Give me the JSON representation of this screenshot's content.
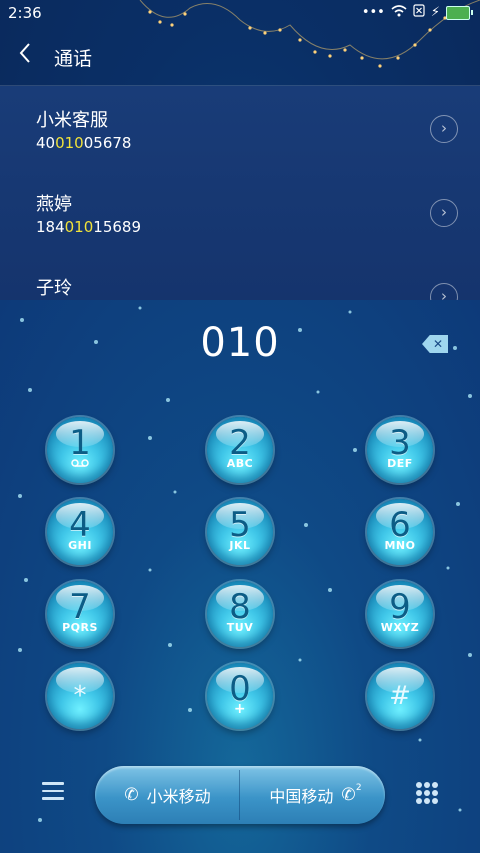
{
  "status_bar": {
    "time": "2:36",
    "icons": [
      "more-icon",
      "wifi-icon",
      "sim-off-icon",
      "charging-icon",
      "battery-icon"
    ]
  },
  "header": {
    "title": "通话"
  },
  "results": [
    {
      "name": "小米客服",
      "number_prefix": "40",
      "number_match": "010",
      "number_suffix": "05678"
    },
    {
      "name": "燕婷",
      "number_prefix": "184",
      "number_match": "010",
      "number_suffix": "15689"
    },
    {
      "name": "子玲",
      "number_prefix": "",
      "number_match": "",
      "number_suffix": ""
    }
  ],
  "dialer": {
    "input": "010",
    "keys": [
      {
        "num": "1",
        "letters": ""
      },
      {
        "num": "2",
        "letters": "ABC"
      },
      {
        "num": "3",
        "letters": "DEF"
      },
      {
        "num": "4",
        "letters": "GHI"
      },
      {
        "num": "5",
        "letters": "JKL"
      },
      {
        "num": "6",
        "letters": "MNO"
      },
      {
        "num": "7",
        "letters": "PQRS"
      },
      {
        "num": "8",
        "letters": "TUV"
      },
      {
        "num": "9",
        "letters": "WXYZ"
      },
      {
        "num": "*",
        "letters": ""
      },
      {
        "num": "0",
        "letters": "+"
      },
      {
        "num": "#",
        "letters": ""
      }
    ]
  },
  "bottom": {
    "call1_label": "小米移动",
    "call2_label": "中国移动",
    "sim2": "2"
  },
  "colors": {
    "match_highlight": "#f0e23a",
    "key_primary": "#3fc6e8",
    "background": "#0d3a79"
  }
}
